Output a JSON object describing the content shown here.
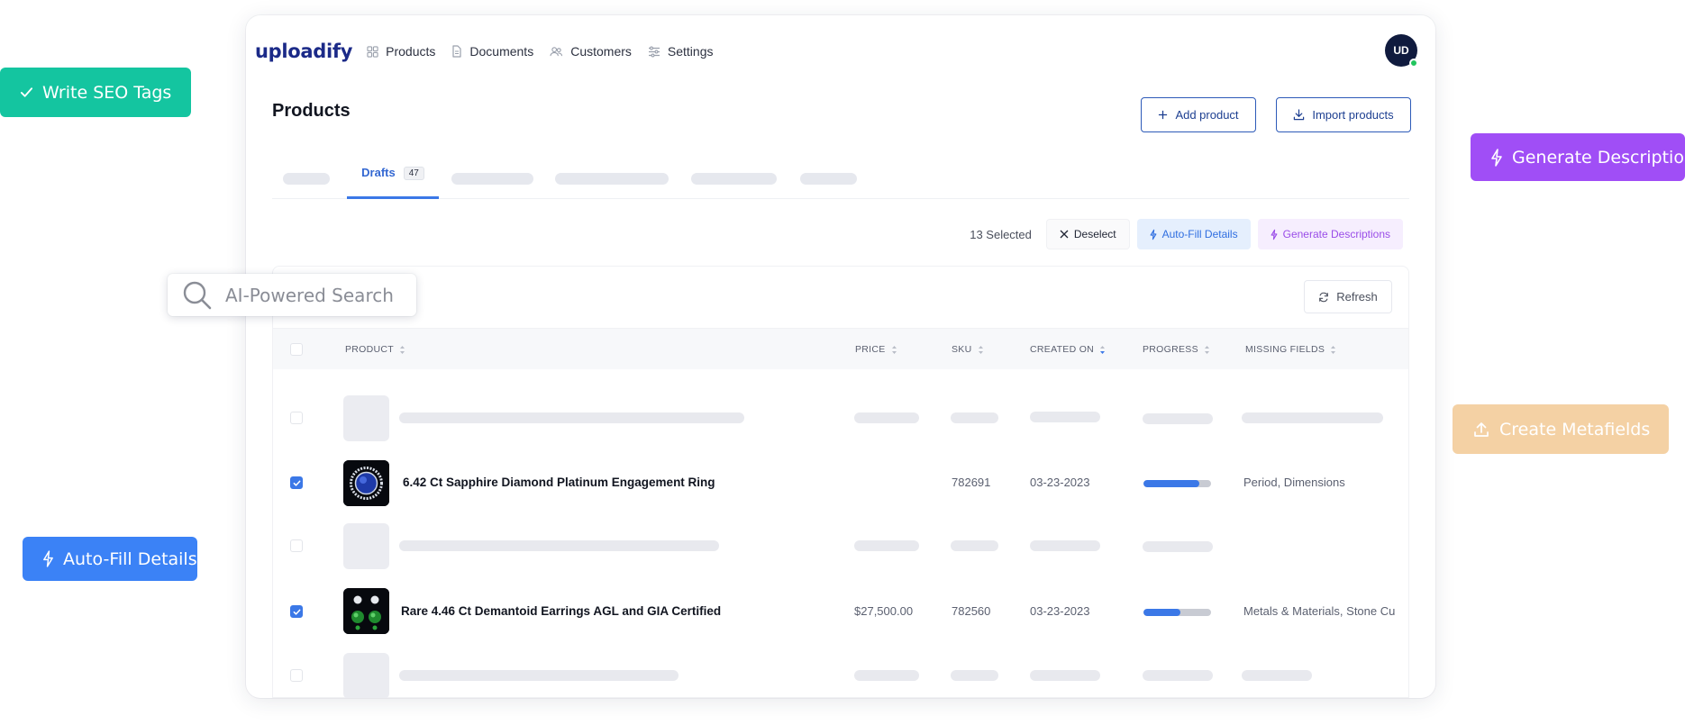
{
  "features": {
    "seo": "Write SEO Tags",
    "generate_description": "Generate Description",
    "metafields": "Create Metafields",
    "autofill": "Auto-Fill Details",
    "search_placeholder": "AI-Powered Search"
  },
  "app": {
    "logo": "uploadify",
    "nav": [
      "Products",
      "Documents",
      "Customers",
      "Settings"
    ],
    "avatar": "UD",
    "page_title": "Products",
    "add_product": "Add product",
    "import_products": "Import products",
    "tab_active": "Drafts",
    "tab_count": "47",
    "selected_count": "13 Selected",
    "deselect": "Deselect",
    "bulk_autofill": "Auto-Fill Details",
    "bulk_generate": "Generate Descriptions",
    "refresh": "Refresh"
  },
  "table": {
    "columns": [
      "PRODUCT",
      "PRICE",
      "SKU",
      "CREATED ON",
      "PROGRESS",
      "MISSING FIELDS"
    ],
    "rows": [
      {
        "name": "6.42 Ct Sapphire Diamond Platinum Engagement Ring",
        "price": "",
        "sku": "782691",
        "created": "03-23-2023",
        "progress": 0.82,
        "missing": "Period, Dimensions"
      },
      {
        "name": "Rare 4.46 Ct Demantoid Earrings AGL and GIA Certified",
        "price": "$27,500.00",
        "sku": "782560",
        "created": "03-23-2023",
        "progress": 0.55,
        "missing": "Metals & Materials, Stone Cu"
      }
    ]
  },
  "colors": {
    "seo": "#14c5a0",
    "generate": "#a04ef6",
    "metafields": "#f4d1a4",
    "autofill": "#3b82f6",
    "accent": "#3b78e7"
  }
}
